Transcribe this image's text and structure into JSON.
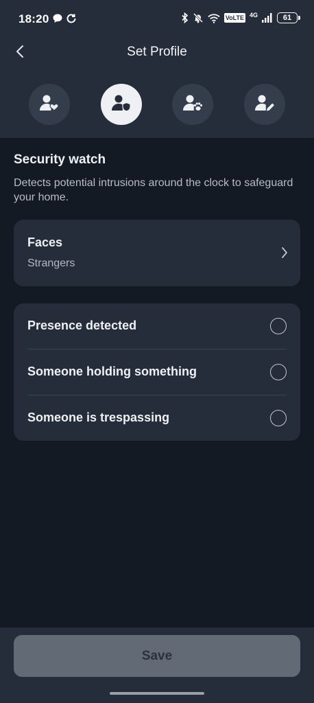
{
  "status_bar": {
    "time": "18:20",
    "volte": "VoLTE",
    "network": "4G",
    "battery": "61"
  },
  "header": {
    "title": "Set Profile",
    "back_icon": "chevron-left-icon"
  },
  "steps": [
    {
      "icon": "person-heart-icon",
      "active": false
    },
    {
      "icon": "person-shield-icon",
      "active": true
    },
    {
      "icon": "person-paw-icon",
      "active": false
    },
    {
      "icon": "person-edit-icon",
      "active": false
    }
  ],
  "section": {
    "title": "Security watch",
    "description": "Detects potential intrusions around the clock to safeguard your home."
  },
  "faces": {
    "label": "Faces",
    "value": "Strangers"
  },
  "options": [
    {
      "label": "Presence detected",
      "selected": false
    },
    {
      "label": "Someone holding something",
      "selected": false
    },
    {
      "label": "Someone is trespassing",
      "selected": false
    }
  ],
  "footer": {
    "save_label": "Save"
  },
  "colors": {
    "background": "#141a24",
    "surface": "#252d3a",
    "active_step": "#eef0f3",
    "save_disabled": "#626a76"
  }
}
